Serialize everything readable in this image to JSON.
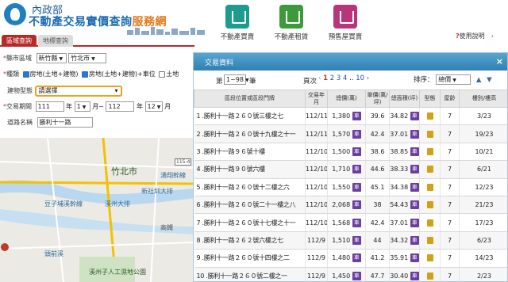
{
  "header": {
    "ministry": "內政部",
    "title_main": "不動產交易實價查詢",
    "title_accent": "服務網",
    "nav": [
      {
        "label": "不動產買賣",
        "icon": "house-sale-icon"
      },
      {
        "label": "不動產租賃",
        "icon": "house-rent-icon"
      },
      {
        "label": "預售屋買賣",
        "icon": "presale-crane-icon"
      }
    ],
    "usage_label": "使用說明"
  },
  "tabs": {
    "query": "區域查詢",
    "map": "地標查詢"
  },
  "form": {
    "county_label": "縣市區域",
    "county_value": "新竹縣",
    "district_value": "竹北市",
    "category_label": "種類",
    "category_options": [
      "房地(土地+建物)",
      "房地(土地+建物)+車位",
      "土地"
    ],
    "building_label": "建物型態",
    "building_value": "請選擇",
    "period_label": "交易期間",
    "from_year": "111",
    "year_unit": "年",
    "from_month": "1",
    "month_unit": "月",
    "tilde": "~",
    "to_year": "112",
    "to_month": "12",
    "road_label": "道路名稱",
    "road_value": "勝利十一路"
  },
  "map": {
    "labels": [
      "竹北市",
      "湧翔幹線",
      "新社圳大排",
      "豆子埔溪幹線",
      "溪州大排",
      "高鐵",
      "頭前溪",
      "溪州子人工濕地公園",
      "115-4"
    ]
  },
  "modal": {
    "title": "交易資料",
    "close": "×",
    "page_prefix": "第",
    "page_select": "1~98",
    "page_suffix": "筆",
    "page_label": "頁次",
    "page_numbers": [
      "1",
      "2",
      "3",
      "4",
      "..",
      "10"
    ],
    "sort_label": "排序：",
    "sort_value": "總價",
    "columns": [
      "區段位置或區段門牌",
      "交易年月",
      "總價(萬)",
      "單價(萬/坪)",
      "總面積(坪)",
      "型態",
      "屋齡",
      "樓別/樓高"
    ],
    "rows": [
      {
        "addr": "1 .勝利十一路２６０號三樓之七",
        "date": "112/11",
        "price": "1,380",
        "unit": "39.6",
        "area": "34.82",
        "age": "7",
        "floor": "3/23"
      },
      {
        "addr": "2 .勝利十一路２６０號十九樓之十一",
        "date": "112/11",
        "price": "1,570",
        "unit": "42.4",
        "area": "37.01",
        "age": "7",
        "floor": "19/23"
      },
      {
        "addr": "3 .勝利十一路９６號十樓",
        "date": "112/10",
        "price": "1,500",
        "unit": "38.6",
        "area": "38.85",
        "age": "7",
        "floor": "10/21"
      },
      {
        "addr": "4 .勝利十一路９０號六樓",
        "date": "112/10",
        "price": "1,710",
        "unit": "44.6",
        "area": "38.33",
        "age": "7",
        "floor": "6/21"
      },
      {
        "addr": "5 .勝利十一路２６０號十二樓之六",
        "date": "112/10",
        "price": "1,550",
        "unit": "45.1",
        "area": "34.38",
        "age": "7",
        "floor": "12/23"
      },
      {
        "addr": "6 .勝利十一路２６０號二十一樓之八",
        "date": "112/10",
        "price": "2,068",
        "unit": "38",
        "area": "54.43",
        "age": "7",
        "floor": "21/23"
      },
      {
        "addr": "7 .勝利十一路２６０號十七樓之十一",
        "date": "112/10",
        "price": "1,568",
        "unit": "42.4",
        "area": "37.01",
        "age": "7",
        "floor": "17/23"
      },
      {
        "addr": "8 .勝利十一路２６２號六樓之七",
        "date": "112/9",
        "price": "1,510",
        "unit": "44",
        "area": "34.32",
        "age": "7",
        "floor": "6/23"
      },
      {
        "addr": "9 .勝利十一路２６０號十四樓之二",
        "date": "112/9",
        "price": "1,480",
        "unit": "41.2",
        "area": "35.91",
        "age": "7",
        "floor": "14/23"
      },
      {
        "addr": "10 .勝利十一路２６０號二樓之一",
        "date": "112/9",
        "price": "1,450",
        "unit": "47.7",
        "area": "30.40",
        "age": "7",
        "floor": "2/23"
      }
    ],
    "badge_char": "車"
  }
}
